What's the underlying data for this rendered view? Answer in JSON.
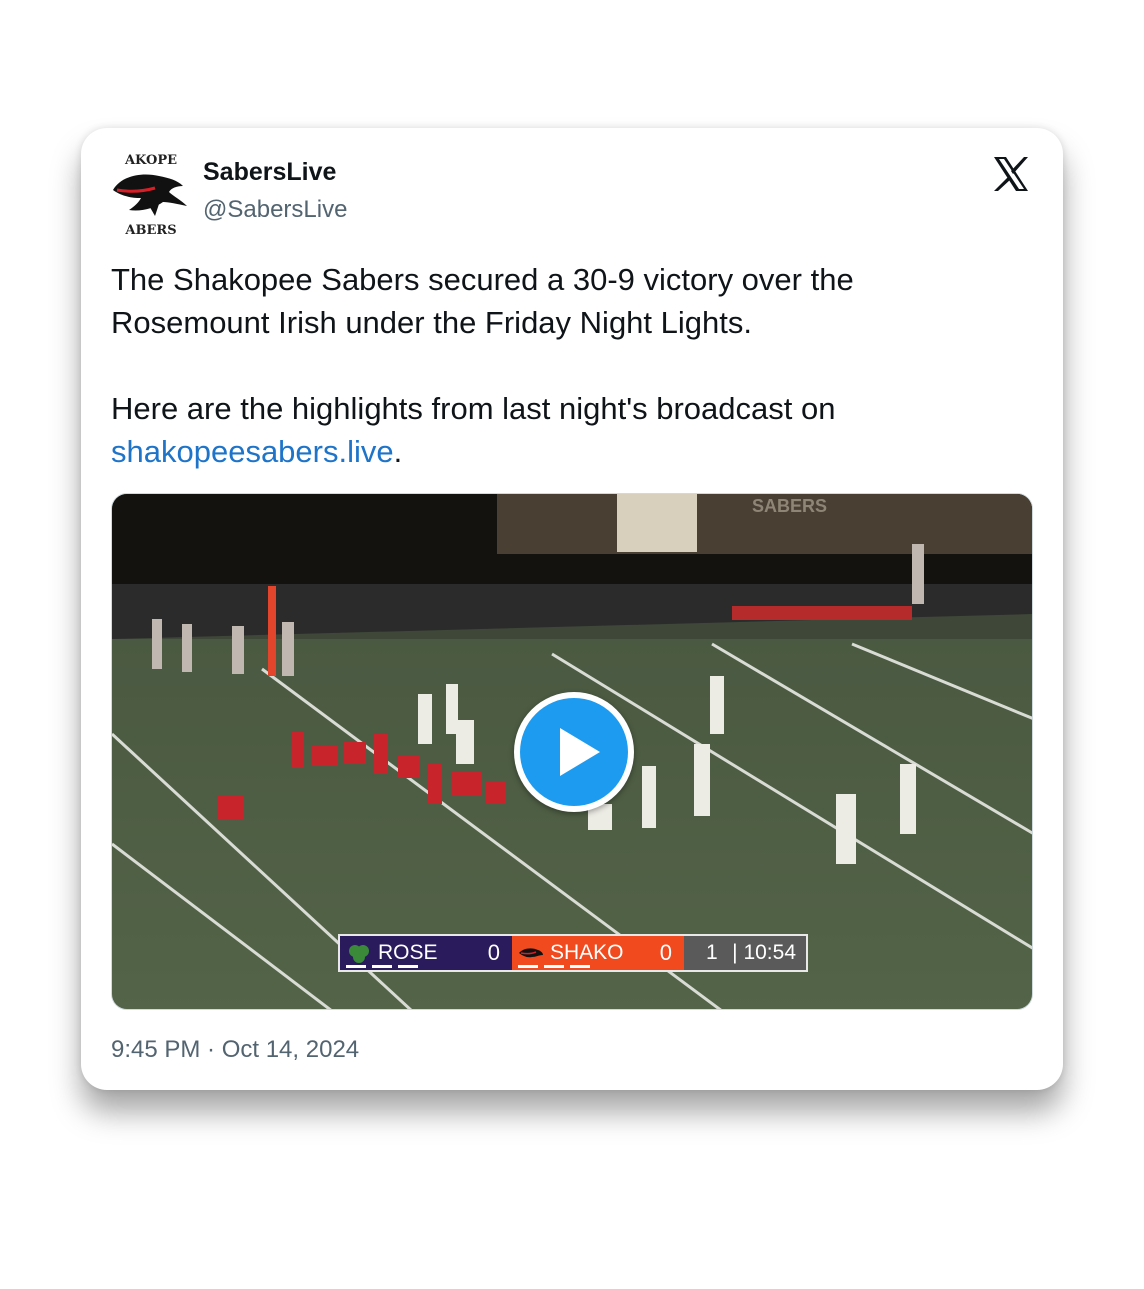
{
  "author": {
    "display_name": "SabersLive",
    "handle": "@SabersLive",
    "avatar_text_top": "AKOPE",
    "avatar_text_bottom": "ABERS"
  },
  "tweet": {
    "line1": "The Shakopee Sabers secured a 30-9 victory over the Rosemount Irish under the Friday Night Lights.",
    "line2_prefix": "Here are the highlights from last night's broadcast on ",
    "link_text": "shakopeesabers.live",
    "line2_suffix": "."
  },
  "media": {
    "type": "video",
    "stadium_sign": "SABERS",
    "scorebug": {
      "team1_name": "ROSE",
      "team1_score": "0",
      "team2_name": "SHAKO",
      "team2_score": "0",
      "quarter": "1",
      "clock": "| 10:54"
    }
  },
  "timestamp": "9:45 PM · Oct 14, 2024",
  "colors": {
    "link": "#1d74c9",
    "play_button": "#1d9bf0",
    "team1": "#2a1c5c",
    "team2": "#f04a1e"
  },
  "icons": {
    "platform": "x-logo-icon",
    "play": "play-icon"
  }
}
